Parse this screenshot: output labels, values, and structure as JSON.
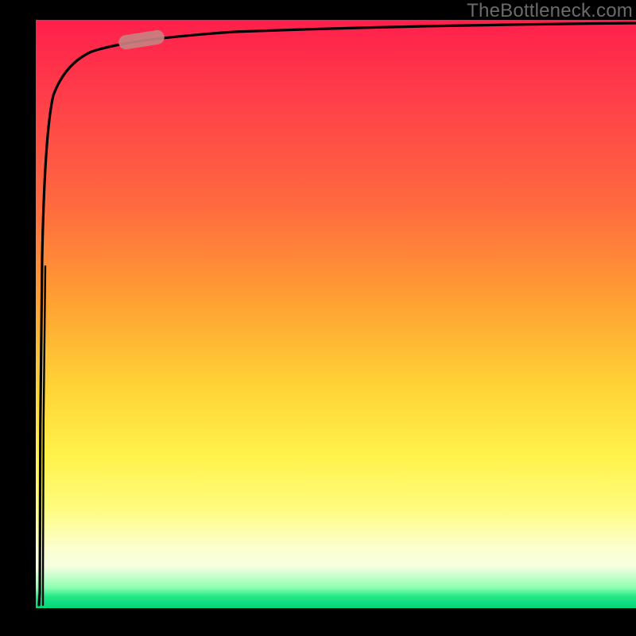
{
  "watermark": "TheBottleneck.com",
  "chart_data": {
    "type": "line",
    "title": "",
    "xlabel": "",
    "ylabel": "",
    "xlim": [
      0,
      100
    ],
    "ylim": [
      0,
      100
    ],
    "grid": false,
    "legend": false,
    "background_gradient": {
      "direction": "vertical",
      "stops": [
        {
          "pos": 0.0,
          "color": "#ff1f4b"
        },
        {
          "pos": 0.32,
          "color": "#ff6b3f"
        },
        {
          "pos": 0.62,
          "color": "#ffd236"
        },
        {
          "pos": 0.83,
          "color": "#fffc7e"
        },
        {
          "pos": 0.93,
          "color": "#f5ffe0"
        },
        {
          "pos": 0.98,
          "color": "#24e887"
        },
        {
          "pos": 1.0,
          "color": "#00d67a"
        }
      ]
    },
    "series": [
      {
        "name": "bottleneck-curve",
        "color": "#000000",
        "x": [
          0.5,
          0.8,
          1.0,
          1.2,
          1.5,
          2.0,
          2.5,
          3.0,
          4.0,
          5.0,
          7.0,
          10.0,
          14.0,
          20.0,
          30.0,
          45.0,
          65.0,
          85.0,
          100.0
        ],
        "values": [
          1.0,
          30.0,
          52.0,
          65.0,
          74.0,
          81.0,
          85.0,
          87.5,
          90.0,
          91.5,
          93.0,
          94.2,
          95.0,
          95.8,
          96.5,
          97.2,
          97.8,
          98.4,
          98.8
        ]
      }
    ],
    "annotations": [
      {
        "name": "highlight-segment",
        "shape": "pill",
        "color": "#c98080",
        "x_range": [
          13.5,
          21.0
        ],
        "y_approx": 95.3
      }
    ]
  }
}
